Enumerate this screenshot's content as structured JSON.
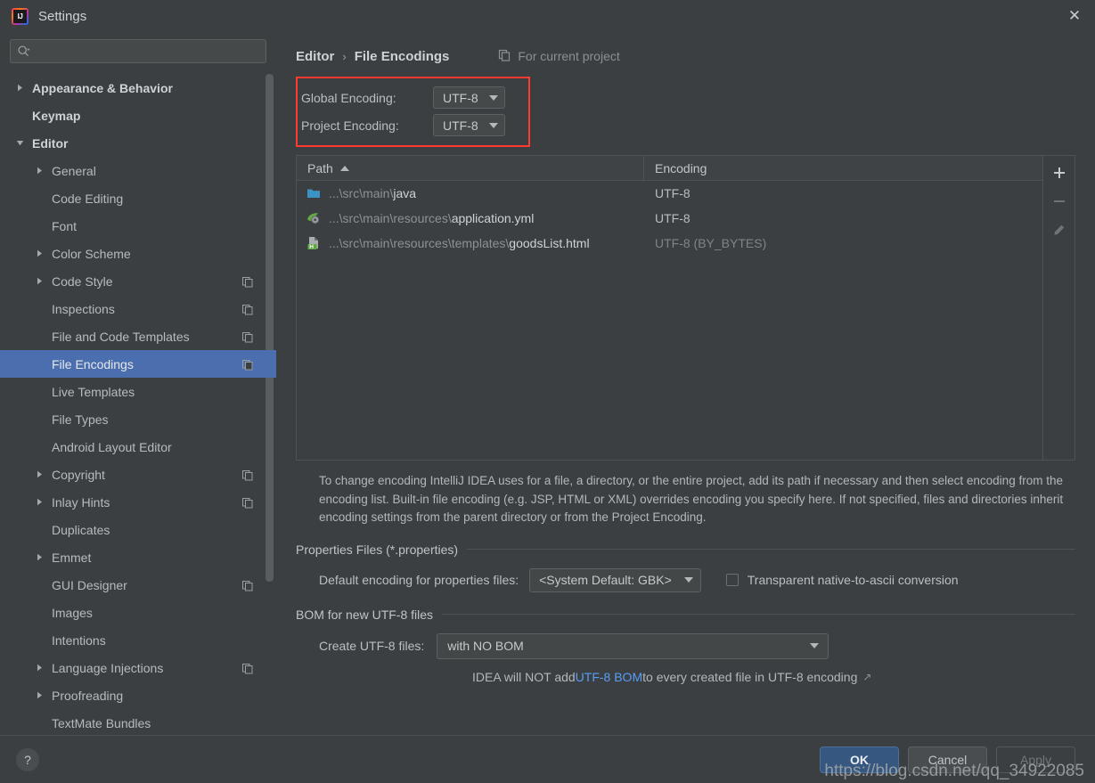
{
  "window": {
    "title": "Settings",
    "logo_icon": "intellij-idea-logo",
    "close_icon": "close-icon"
  },
  "sidebar": {
    "search": {
      "placeholder": "",
      "value": "",
      "icon": "search-icon"
    },
    "items": [
      {
        "label": "Appearance & Behavior",
        "arrow": "right",
        "indent": 0,
        "bold": true,
        "badge": false,
        "selected": false
      },
      {
        "label": "Keymap",
        "arrow": "none",
        "indent": 0,
        "bold": true,
        "badge": false,
        "selected": false
      },
      {
        "label": "Editor",
        "arrow": "down",
        "indent": 0,
        "bold": true,
        "badge": false,
        "selected": false
      },
      {
        "label": "General",
        "arrow": "right",
        "indent": 1,
        "bold": false,
        "badge": false,
        "selected": false
      },
      {
        "label": "Code Editing",
        "arrow": "none",
        "indent": 1,
        "bold": false,
        "badge": false,
        "selected": false
      },
      {
        "label": "Font",
        "arrow": "none",
        "indent": 1,
        "bold": false,
        "badge": false,
        "selected": false
      },
      {
        "label": "Color Scheme",
        "arrow": "right",
        "indent": 1,
        "bold": false,
        "badge": false,
        "selected": false
      },
      {
        "label": "Code Style",
        "arrow": "right",
        "indent": 1,
        "bold": false,
        "badge": true,
        "selected": false
      },
      {
        "label": "Inspections",
        "arrow": "none",
        "indent": 1,
        "bold": false,
        "badge": true,
        "selected": false
      },
      {
        "label": "File and Code Templates",
        "arrow": "none",
        "indent": 1,
        "bold": false,
        "badge": true,
        "selected": false
      },
      {
        "label": "File Encodings",
        "arrow": "none",
        "indent": 1,
        "bold": false,
        "badge": true,
        "selected": true
      },
      {
        "label": "Live Templates",
        "arrow": "none",
        "indent": 1,
        "bold": false,
        "badge": false,
        "selected": false
      },
      {
        "label": "File Types",
        "arrow": "none",
        "indent": 1,
        "bold": false,
        "badge": false,
        "selected": false
      },
      {
        "label": "Android Layout Editor",
        "arrow": "none",
        "indent": 1,
        "bold": false,
        "badge": false,
        "selected": false
      },
      {
        "label": "Copyright",
        "arrow": "right",
        "indent": 1,
        "bold": false,
        "badge": true,
        "selected": false
      },
      {
        "label": "Inlay Hints",
        "arrow": "right",
        "indent": 1,
        "bold": false,
        "badge": true,
        "selected": false
      },
      {
        "label": "Duplicates",
        "arrow": "none",
        "indent": 1,
        "bold": false,
        "badge": false,
        "selected": false
      },
      {
        "label": "Emmet",
        "arrow": "right",
        "indent": 1,
        "bold": false,
        "badge": false,
        "selected": false
      },
      {
        "label": "GUI Designer",
        "arrow": "none",
        "indent": 1,
        "bold": false,
        "badge": true,
        "selected": false
      },
      {
        "label": "Images",
        "arrow": "none",
        "indent": 1,
        "bold": false,
        "badge": false,
        "selected": false
      },
      {
        "label": "Intentions",
        "arrow": "none",
        "indent": 1,
        "bold": false,
        "badge": false,
        "selected": false
      },
      {
        "label": "Language Injections",
        "arrow": "right",
        "indent": 1,
        "bold": false,
        "badge": true,
        "selected": false
      },
      {
        "label": "Proofreading",
        "arrow": "right",
        "indent": 1,
        "bold": false,
        "badge": false,
        "selected": false
      },
      {
        "label": "TextMate Bundles",
        "arrow": "none",
        "indent": 1,
        "bold": false,
        "badge": false,
        "selected": false
      }
    ]
  },
  "breadcrumb": {
    "parent": "Editor",
    "separator": "›",
    "current": "File Encodings",
    "scope_label": "For current project",
    "scope_icon": "copy-pages-icon"
  },
  "encoding": {
    "global_label": "Global Encoding:",
    "global_value": "UTF-8",
    "project_label": "Project Encoding:",
    "project_value": "UTF-8",
    "highlight_color": "#ff3b30"
  },
  "table": {
    "columns": [
      "Path",
      "Encoding"
    ],
    "sort_column": "Path",
    "sort_direction": "asc",
    "rows": [
      {
        "icon": "folder-icon",
        "path_dim": "...\\src\\main\\",
        "path_name": "java",
        "encoding": "UTF-8",
        "encoding_dim": false
      },
      {
        "icon": "yaml-file-icon",
        "path_dim": "...\\src\\main\\resources\\",
        "path_name": "application.yml",
        "encoding": "UTF-8",
        "encoding_dim": false
      },
      {
        "icon": "html-file-icon",
        "path_dim": "...\\src\\main\\resources\\templates\\",
        "path_name": "goodsList.html",
        "encoding": "UTF-8 (BY_BYTES)",
        "encoding_dim": true
      }
    ],
    "tools": [
      {
        "name": "add-path-button",
        "icon": "plus-icon",
        "enabled": true
      },
      {
        "name": "remove-path-button",
        "icon": "minus-icon",
        "enabled": false
      },
      {
        "name": "edit-path-button",
        "icon": "pencil-icon",
        "enabled": false
      }
    ]
  },
  "description": "To change encoding IntelliJ IDEA uses for a file, a directory, or the entire project, add its path if necessary and then select encoding from the encoding list. Built-in file encoding (e.g. JSP, HTML or XML) overrides encoding you specify here. If not specified, files and directories inherit encoding settings from the parent directory or from the Project Encoding.",
  "properties_section": {
    "title": "Properties Files (*.properties)",
    "default_encoding_label": "Default encoding for properties files:",
    "default_encoding_value": "<System Default: GBK>",
    "transparent_label": "Transparent native-to-ascii conversion",
    "transparent_checked": false
  },
  "bom_section": {
    "title": "BOM for new UTF-8 files",
    "create_label": "Create UTF-8 files:",
    "create_value": "with NO BOM",
    "note_prefix": "IDEA will NOT add ",
    "note_link": "UTF-8 BOM",
    "note_suffix": " to every created file in UTF-8 encoding",
    "external_arrow": "↗"
  },
  "footer": {
    "help_label": "?",
    "ok_label": "OK",
    "cancel_label": "Cancel",
    "apply_label": "Apply",
    "apply_enabled": false,
    "watermark": "https://blog.csdn.net/qq_34922085"
  }
}
